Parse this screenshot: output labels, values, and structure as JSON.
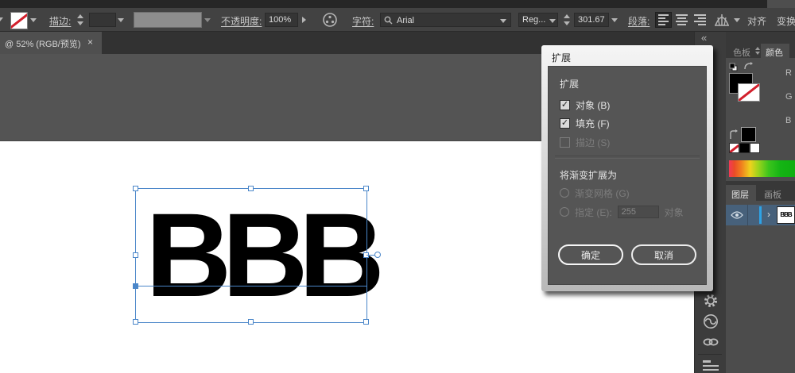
{
  "toolbar": {
    "stroke_label": "描边:",
    "opacity_label": "不透明度:",
    "opacity_value": "100%",
    "character_label": "字符:",
    "font_name": "Arial",
    "font_style": "Reg...",
    "font_size": "301.67",
    "paragraph_label": "段落:",
    "align_label": "对齐",
    "transform_label": "变换"
  },
  "tab": {
    "title": "@ 52% (RGB/预览)"
  },
  "canvas": {
    "text": "BBB"
  },
  "dialog": {
    "title": "扩展",
    "section_expand": "扩展",
    "checkboxes": [
      {
        "label": "对象 (B)"
      },
      {
        "label": "填充 (F)"
      },
      {
        "label": "描边 (S)"
      }
    ],
    "section_gradient": "将渐变扩展为",
    "radios": [
      {
        "label": "渐变网格 (G)"
      },
      {
        "label": "指定 (E):"
      }
    ],
    "specify_value": "255",
    "specify_suffix": "对象",
    "ok_label": "确定",
    "cancel_label": "取消"
  },
  "panels": {
    "swatches_tab": "色板",
    "color_tab": "颜色",
    "rgb": {
      "r": "R",
      "g": "G",
      "b": "B"
    },
    "layers_tab": "图层",
    "artboards_tab": "画板",
    "layer_thumb_text": "BBB"
  },
  "icons": {
    "close": "×",
    "collapse": "«",
    "check": "✓",
    "expander": "›",
    "cc": "∞"
  },
  "colors": {
    "selection_blue": "#4a86c9",
    "layer_row_blue": "#47617b",
    "accent_blue": "#2ea3e6",
    "none_red": "#d21f2c"
  }
}
